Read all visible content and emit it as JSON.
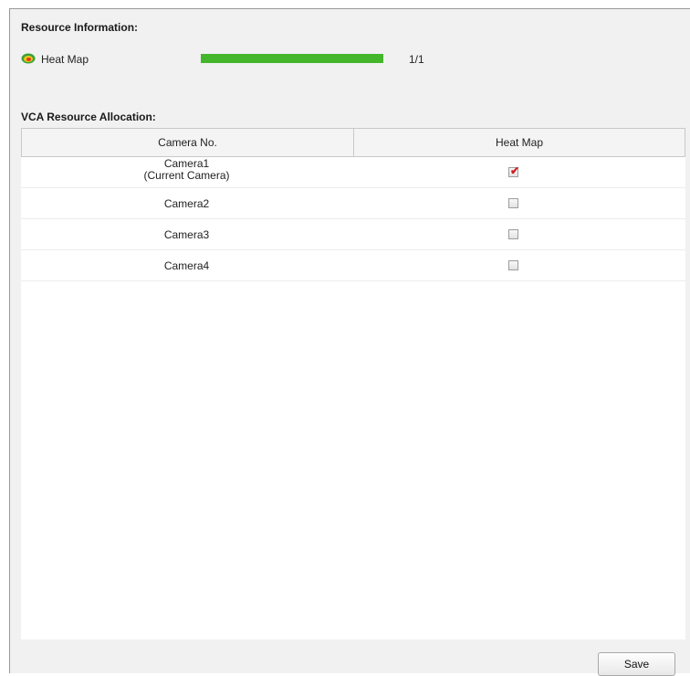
{
  "resource_info": {
    "title": "Resource Information:",
    "item": {
      "icon": "heat-map-icon",
      "label": "Heat Map",
      "usage_fraction": 1.0,
      "count_text": "1/1",
      "bar_color": "#44b62c"
    }
  },
  "allocation": {
    "title": "VCA Resource Allocation:",
    "columns": [
      "Camera No.",
      "Heat Map"
    ],
    "rows": [
      {
        "name_line1": "Camera1",
        "name_line2": "(Current Camera)",
        "checked": true
      },
      {
        "name_line1": "Camera2",
        "name_line2": "",
        "checked": false
      },
      {
        "name_line1": "Camera3",
        "name_line2": "",
        "checked": false
      },
      {
        "name_line1": "Camera4",
        "name_line2": "",
        "checked": false
      }
    ]
  },
  "footer": {
    "save_label": "Save"
  }
}
